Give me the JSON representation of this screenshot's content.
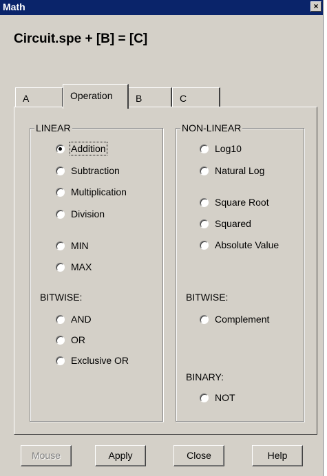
{
  "window": {
    "title": "Math",
    "close_symbol": "×"
  },
  "formula": "Circuit.spe + [B] = [C]",
  "tabs": [
    {
      "label": "A",
      "active": false
    },
    {
      "label": "Operation",
      "active": true
    },
    {
      "label": "B",
      "active": false
    },
    {
      "label": "C",
      "active": false
    }
  ],
  "linear": {
    "title": "LINEAR",
    "options": [
      "Addition",
      "Subtraction",
      "Multiplication",
      "Division",
      "MIN",
      "MAX"
    ],
    "selected": "Addition",
    "bitwise_title": "BITWISE:",
    "bitwise_options": [
      "AND",
      "OR",
      "Exclusive OR"
    ]
  },
  "nonlinear": {
    "title": "NON-LINEAR",
    "options": [
      "Log10",
      "Natural Log",
      "Square Root",
      "Squared",
      "Absolute Value"
    ],
    "bitwise_title": "BITWISE:",
    "bitwise_options": [
      "Complement"
    ],
    "binary_title": "BINARY:",
    "binary_options": [
      "NOT"
    ]
  },
  "buttons": {
    "mouse": "Mouse",
    "mouse_enabled": false,
    "apply": "Apply",
    "close": "Close",
    "help": "Help"
  }
}
